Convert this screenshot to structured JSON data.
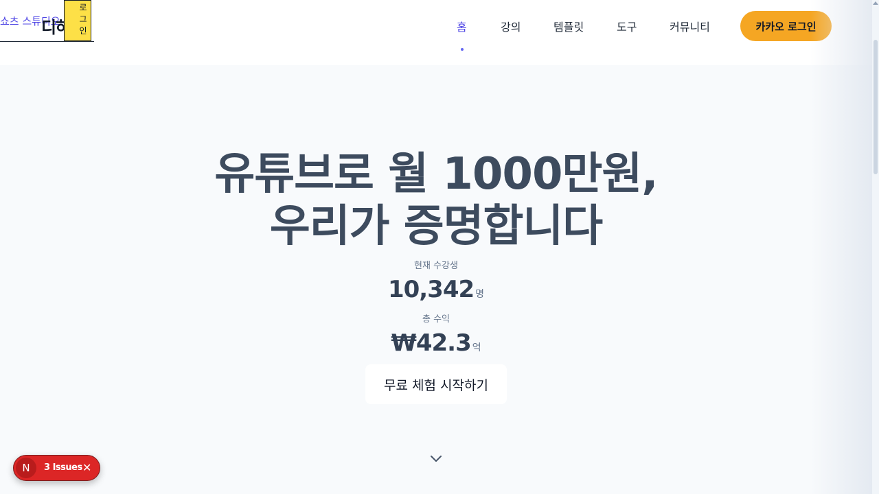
{
  "header": {
    "brand_link": "쇼츠 스튜디오",
    "logo_text": "디하클",
    "login_box": [
      "로",
      "그",
      "인"
    ],
    "nav": [
      {
        "label": "홈",
        "active": true
      },
      {
        "label": "강의",
        "active": false
      },
      {
        "label": "템플릿",
        "active": false
      },
      {
        "label": "도구",
        "active": false
      },
      {
        "label": "커뮤니티",
        "active": false
      }
    ],
    "kakao_login": "카카오 로그인"
  },
  "hero": {
    "headline_line1": "유튜브로 월 1000만원,",
    "headline_line2": "우리가 증명합니다",
    "students_label": "현재 수강생",
    "students_value": "10,342",
    "students_unit": "명",
    "revenue_label": "총 수익",
    "revenue_value": "₩42.3",
    "revenue_unit": "억",
    "cta_label": "무료 체험 시작하기",
    "scroll_icon": "chevron-down-icon"
  },
  "devtools": {
    "avatar_letter": "N",
    "issues_label": "3 Issues",
    "close_icon": "close-icon"
  },
  "colors": {
    "accent": "#4f46e5",
    "kakao": "#f5a623",
    "headline": "#3d4b5e",
    "hero_bg": "#f8fafc",
    "issues_bg": "#dc2626"
  }
}
